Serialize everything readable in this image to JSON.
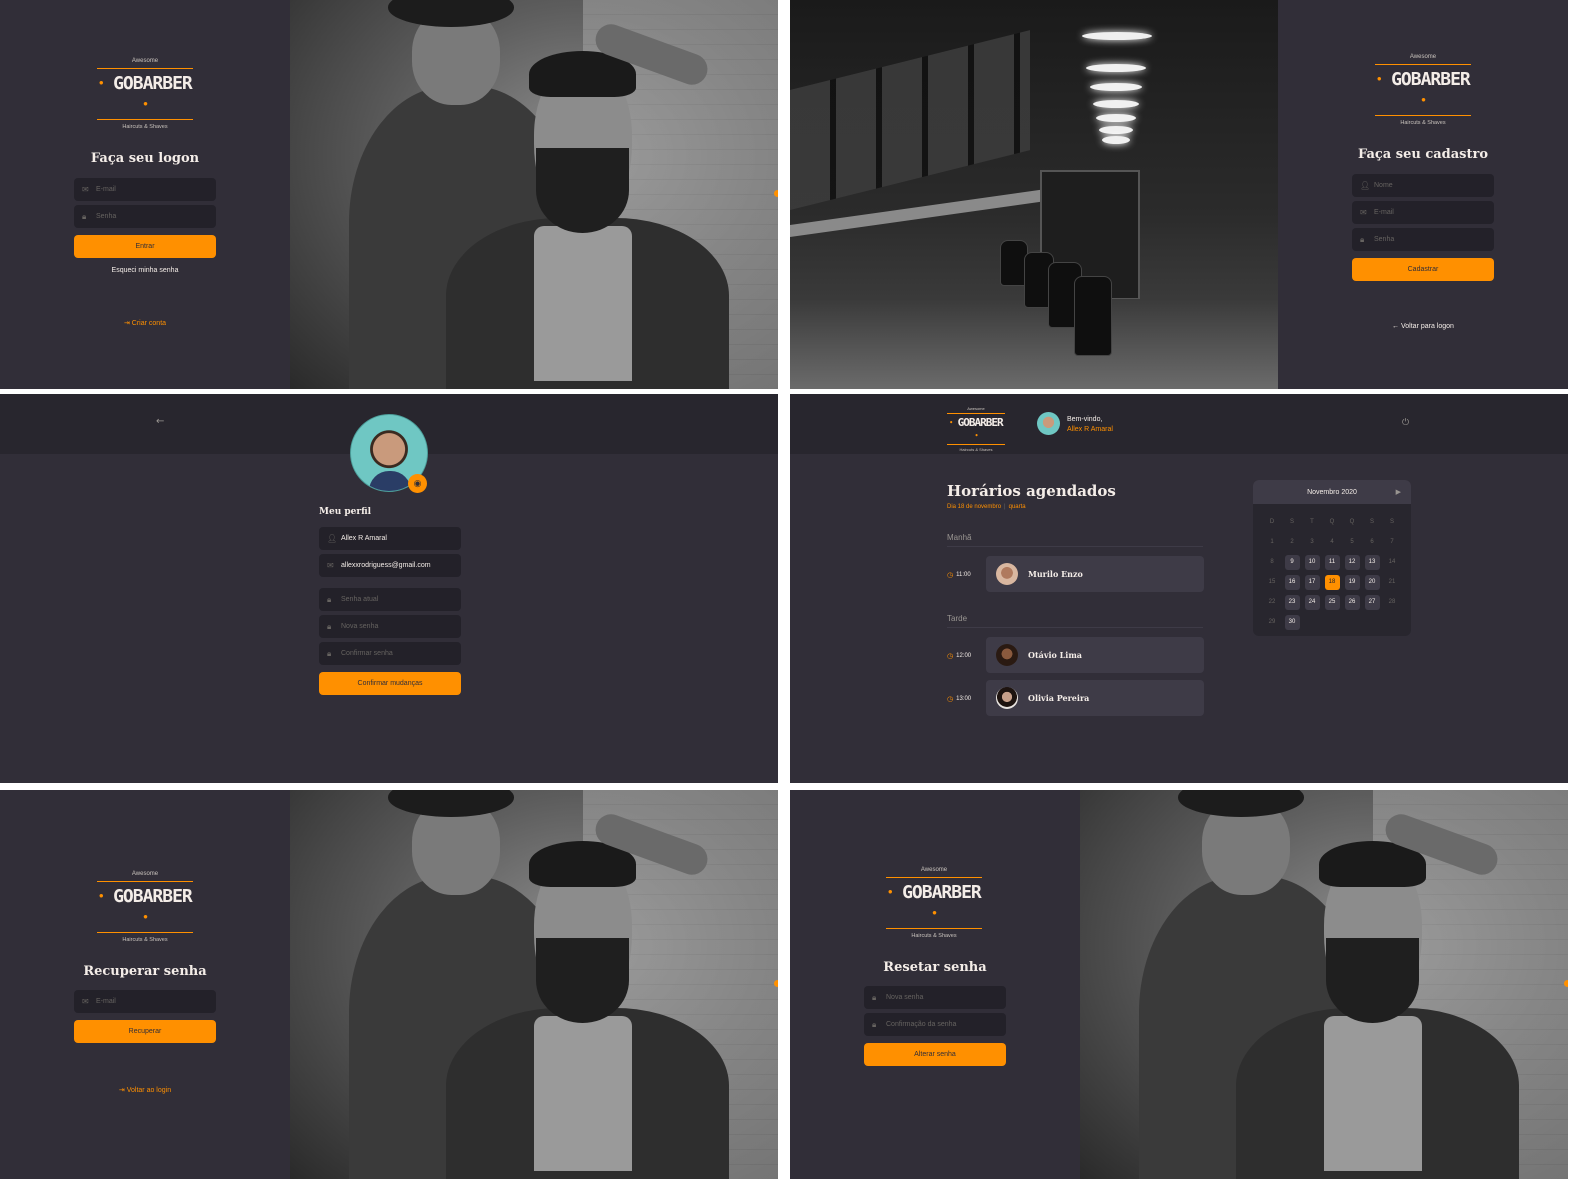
{
  "logo": {
    "top": "Awesome",
    "main": "GOBARBER",
    "sub": "Haircuts & Shaves"
  },
  "login": {
    "title": "Faça seu logon",
    "email_placeholder": "E-mail",
    "password_placeholder": "Senha",
    "submit": "Entrar",
    "forgot": "Esqueci minha senha",
    "create_account": "Criar conta"
  },
  "signup": {
    "title": "Faça seu cadastro",
    "name_placeholder": "Nome",
    "email_placeholder": "E-mail",
    "password_placeholder": "Senha",
    "submit": "Cadastrar",
    "back": "Voltar para logon"
  },
  "profile": {
    "title": "Meu perfil",
    "name_value": "Allex R Amaral",
    "email_value": "allexxrodriguess@gmail.com",
    "current_password_placeholder": "Senha atual",
    "new_password_placeholder": "Nova senha",
    "confirm_password_placeholder": "Confirmar senha",
    "submit": "Confirmar mudanças"
  },
  "dashboard": {
    "welcome": "Bem-vindo,",
    "user_name": "Allex R Amaral",
    "title": "Horários agendados",
    "date_label": "Dia 18 de novembro",
    "weekday": "quarta",
    "morning_label": "Manhã",
    "afternoon_label": "Tarde",
    "appointments": [
      {
        "time": "11:00",
        "name": "Murilo Enzo"
      },
      {
        "time": "12:00",
        "name": "Otávio Lima"
      },
      {
        "time": "13:00",
        "name": "Olivia Pereira"
      }
    ],
    "calendar": {
      "month": "Novembro 2020",
      "weekdays": [
        "D",
        "S",
        "T",
        "Q",
        "Q",
        "S",
        "S"
      ],
      "selected_day": 18,
      "available_days": [
        9,
        10,
        11,
        12,
        13,
        16,
        17,
        18,
        19,
        20,
        23,
        24,
        25,
        26,
        27,
        30
      ],
      "days_in_month": 30
    }
  },
  "recover": {
    "title": "Recuperar senha",
    "email_placeholder": "E-mail",
    "submit": "Recuperar",
    "back": "Voltar ao login"
  },
  "reset": {
    "title": "Resetar senha",
    "new_password_placeholder": "Nova senha",
    "confirm_placeholder": "Confirmação da senha",
    "submit": "Alterar senha"
  },
  "colors": {
    "background": "#312e38",
    "input": "#232129",
    "accent": "#ff9000",
    "card": "#3e3b47",
    "text": "#f4ede8"
  },
  "icons": [
    "mail-icon",
    "lock-icon",
    "user-icon",
    "login-icon",
    "arrow-left-icon",
    "camera-icon",
    "power-icon",
    "clock-icon",
    "chevron-right-icon"
  ]
}
